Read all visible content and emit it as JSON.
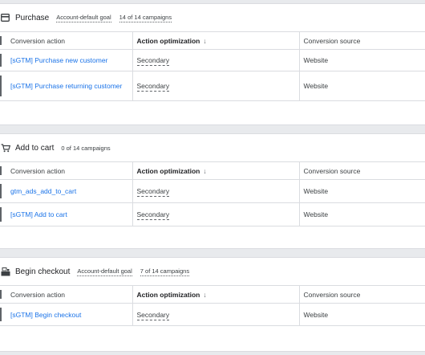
{
  "sections": [
    {
      "title": "Purchase",
      "icon": "credit-card-icon",
      "goal_label": "Account-default goal",
      "campaigns": "14 of 14 campaigns",
      "columns": [
        "Conversion action",
        "Action optimization",
        "Conversion source"
      ],
      "rows": [
        {
          "action": "[sGTM] Purchase new customer",
          "optimization": "Secondary",
          "source": "Website"
        },
        {
          "action": "[sGTM] Purchase returning customer",
          "optimization": "Secondary",
          "source": "Website"
        }
      ]
    },
    {
      "title": "Add to cart",
      "icon": "shopping-cart-icon",
      "goal_label": "",
      "campaigns": "0 of 14 campaigns",
      "columns": [
        "Conversion action",
        "Action optimization",
        "Conversion source"
      ],
      "rows": [
        {
          "action": "gtm_ads_add_to_cart",
          "optimization": "Secondary",
          "source": "Website"
        },
        {
          "action": "[sGTM] Add to cart",
          "optimization": "Secondary",
          "source": "Website"
        }
      ]
    },
    {
      "title": "Begin checkout",
      "icon": "checkout-register-icon",
      "goal_label": "Account-default goal",
      "campaigns": "7 of 14 campaigns",
      "columns": [
        "Conversion action",
        "Action optimization",
        "Conversion source"
      ],
      "rows": [
        {
          "action": "[sGTM] Begin checkout",
          "optimization": "Secondary",
          "source": "Website"
        }
      ]
    }
  ],
  "sort_icon": "arrow-down-icon",
  "colors": {
    "link": "#1a73e8",
    "background": "#e8eaed",
    "card": "#ffffff",
    "border": "#dadce0"
  }
}
